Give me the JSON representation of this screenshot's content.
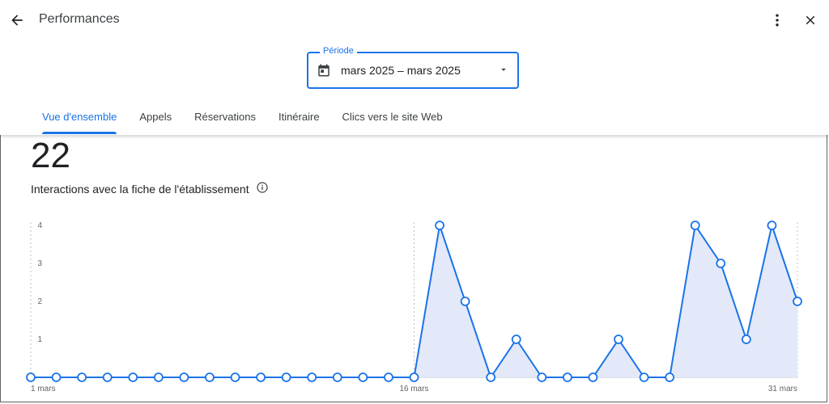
{
  "header": {
    "title": "Performances",
    "back_icon": "arrow-left-icon",
    "more_icon": "more-vert-icon",
    "close_icon": "close-icon"
  },
  "period": {
    "label": "Période",
    "value": "mars 2025 – mars 2025"
  },
  "tabs": [
    {
      "label": "Vue d'ensemble",
      "active": true
    },
    {
      "label": "Appels",
      "active": false
    },
    {
      "label": "Réservations",
      "active": false
    },
    {
      "label": "Itinéraire",
      "active": false
    },
    {
      "label": "Clics vers le site Web",
      "active": false
    }
  ],
  "summary": {
    "total": "22",
    "label": "Interactions avec la fiche de l'établissement"
  },
  "colors": {
    "accent": "#1a73e8",
    "fill": "#e3e9f8"
  },
  "chart_data": {
    "type": "area",
    "x": [
      1,
      2,
      3,
      4,
      5,
      6,
      7,
      8,
      9,
      10,
      11,
      12,
      13,
      14,
      15,
      16,
      17,
      18,
      19,
      20,
      21,
      22,
      23,
      24,
      25,
      26,
      27,
      28,
      29,
      30,
      31
    ],
    "values": [
      0,
      0,
      0,
      0,
      0,
      0,
      0,
      0,
      0,
      0,
      0,
      0,
      0,
      0,
      0,
      0,
      4,
      2,
      0,
      1,
      0,
      0,
      0,
      1,
      0,
      0,
      4,
      3,
      1,
      4,
      2
    ],
    "xticks": [
      {
        "day": 1,
        "label": "1 mars"
      },
      {
        "day": 16,
        "label": "16 mars"
      },
      {
        "day": 31,
        "label": "31 mars"
      }
    ],
    "yticks": [
      1,
      2,
      3,
      4
    ],
    "ylim": [
      0,
      4
    ]
  }
}
